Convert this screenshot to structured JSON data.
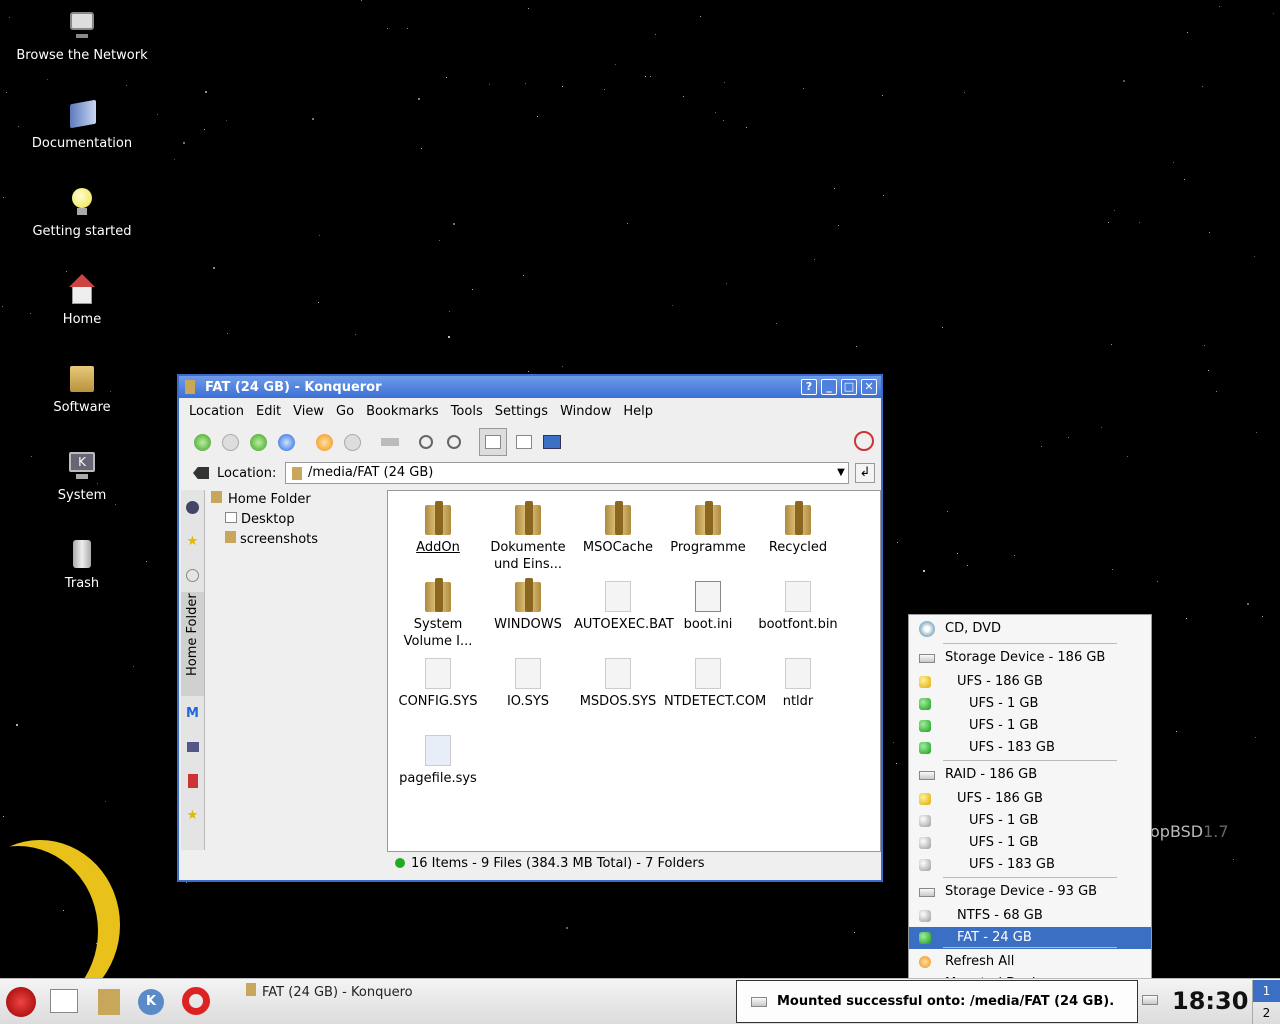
{
  "desktop": {
    "icons": [
      {
        "label": "Browse the Network",
        "icon": "network-icon"
      },
      {
        "label": "Documentation",
        "icon": "book-icon"
      },
      {
        "label": "Getting started",
        "icon": "lightbulb-icon"
      },
      {
        "label": "Home",
        "icon": "home-icon"
      },
      {
        "label": "Software",
        "icon": "package-icon"
      },
      {
        "label": "System",
        "icon": "computer-icon"
      },
      {
        "label": "Trash",
        "icon": "trash-icon"
      }
    ],
    "brand": "opBSD",
    "brand_version": "1.7"
  },
  "window": {
    "title": "FAT (24 GB) - Konqueror",
    "title_buttons": [
      "?",
      "_",
      "□",
      "✕"
    ],
    "menu": [
      "Location",
      "Edit",
      "View",
      "Go",
      "Bookmarks",
      "Tools",
      "Settings",
      "Window",
      "Help"
    ],
    "location_label": "Location:",
    "location_value": "/media/FAT (24 GB)",
    "sidebar_tab": "Home Folder",
    "tree": [
      "Home Folder",
      "Desktop",
      "screenshots"
    ],
    "files": [
      {
        "name": "AddOn",
        "type": "folder"
      },
      {
        "name": "Dokumente und Eins...",
        "type": "folder"
      },
      {
        "name": "MSOCache",
        "type": "folder"
      },
      {
        "name": "Programme",
        "type": "folder"
      },
      {
        "name": "Recycled",
        "type": "folder"
      },
      {
        "name": "System Volume I...",
        "type": "folder"
      },
      {
        "name": "WINDOWS",
        "type": "folder"
      },
      {
        "name": "AUTOEXEC.BAT",
        "type": "file"
      },
      {
        "name": "boot.ini",
        "type": "text"
      },
      {
        "name": "bootfont.bin",
        "type": "file"
      },
      {
        "name": "CONFIG.SYS",
        "type": "file"
      },
      {
        "name": "IO.SYS",
        "type": "file"
      },
      {
        "name": "MSDOS.SYS",
        "type": "file"
      },
      {
        "name": "NTDETECT.COM",
        "type": "file"
      },
      {
        "name": "ntldr",
        "type": "file"
      },
      {
        "name": "pagefile.sys",
        "type": "file"
      }
    ],
    "status": "16 Items - 9 Files (384.3 MB Total) - 7 Folders"
  },
  "devices_menu": {
    "items": [
      {
        "label": "CD, DVD",
        "icon": "cd-icon",
        "level": 0
      },
      {
        "label": "Storage Device - 186 GB",
        "icon": "drive-icon",
        "level": 0
      },
      {
        "label": "UFS - 186 GB",
        "icon": "yellow-gem-icon",
        "level": 1
      },
      {
        "label": "UFS - 1 GB",
        "icon": "green-gem-icon",
        "level": 2
      },
      {
        "label": "UFS - 1 GB",
        "icon": "green-gem-icon",
        "level": 2
      },
      {
        "label": "UFS - 183 GB",
        "icon": "green-gem-icon",
        "level": 2
      },
      {
        "label": "RAID - 186 GB",
        "icon": "drive-icon",
        "level": 0
      },
      {
        "label": "UFS - 186 GB",
        "icon": "yellow-gem-icon",
        "level": 1
      },
      {
        "label": "UFS - 1 GB",
        "icon": "gray-gem-icon",
        "level": 2
      },
      {
        "label": "UFS - 1 GB",
        "icon": "gray-gem-icon",
        "level": 2
      },
      {
        "label": "UFS - 183 GB",
        "icon": "gray-gem-icon",
        "level": 2
      },
      {
        "label": "Storage Device - 93 GB",
        "icon": "drive-icon",
        "level": 0
      },
      {
        "label": "NTFS - 68 GB",
        "icon": "gray-gem-icon",
        "level": 1
      },
      {
        "label": "FAT - 24 GB",
        "icon": "green-gem-icon",
        "level": 1,
        "selected": true
      },
      {
        "label": "Refresh All",
        "icon": "refresh-icon",
        "level": 0
      },
      {
        "label": "Mounted Devices",
        "icon": "folder-icon",
        "level": 0
      }
    ]
  },
  "taskbar": {
    "task": "FAT (24 GB) - Konquero",
    "notification": "Mounted successful onto: /media/FAT (24 GB).",
    "clock": "18:30",
    "pager": [
      "1",
      "2"
    ]
  }
}
